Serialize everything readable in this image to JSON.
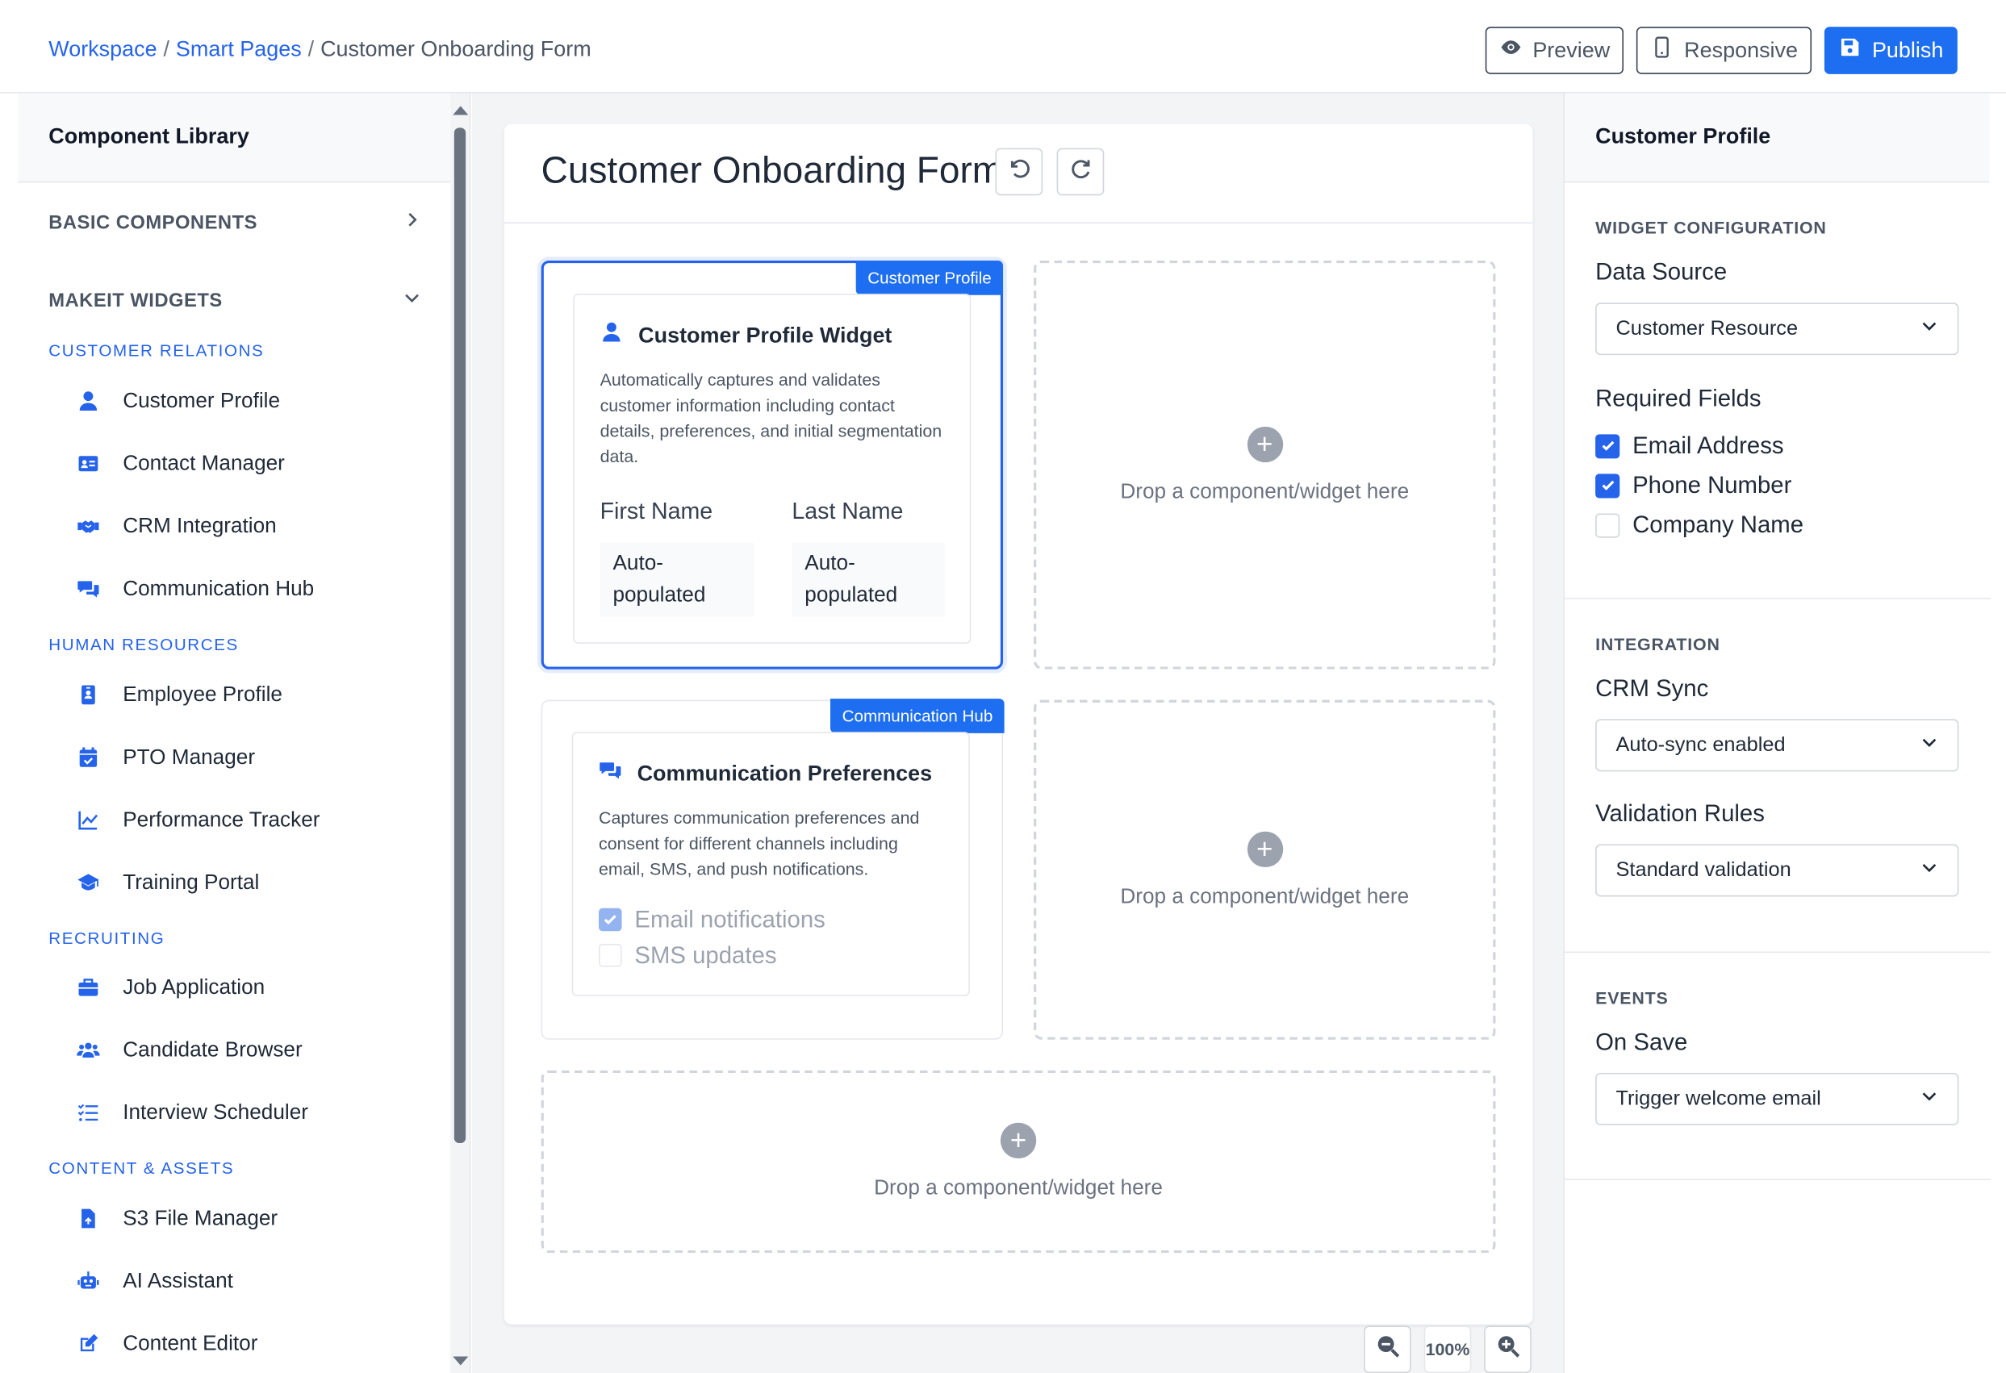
{
  "breadcrumb": {
    "items": [
      "Workspace",
      "Smart Pages",
      "Customer Onboarding Form"
    ],
    "separator": "/"
  },
  "toolbar": {
    "preview_label": "Preview",
    "responsive_label": "Responsive",
    "publish_label": "Publish"
  },
  "sidebar": {
    "title": "Component Library",
    "basic_group": "BASIC COMPONENTS",
    "makeit_group": "MAKEIT WIDGETS",
    "sections": [
      {
        "title": "CUSTOMER RELATIONS",
        "items": [
          {
            "label": "Customer Profile",
            "icon": "user-icon"
          },
          {
            "label": "Contact Manager",
            "icon": "address-card-icon"
          },
          {
            "label": "CRM Integration",
            "icon": "handshake-icon"
          },
          {
            "label": "Communication Hub",
            "icon": "comments-icon"
          }
        ]
      },
      {
        "title": "HUMAN RESOURCES",
        "items": [
          {
            "label": "Employee Profile",
            "icon": "id-badge-icon"
          },
          {
            "label": "PTO Manager",
            "icon": "calendar-check-icon"
          },
          {
            "label": "Performance Tracker",
            "icon": "chart-line-icon"
          },
          {
            "label": "Training Portal",
            "icon": "graduation-cap-icon"
          }
        ]
      },
      {
        "title": "RECRUITING",
        "items": [
          {
            "label": "Job Application",
            "icon": "briefcase-icon"
          },
          {
            "label": "Candidate Browser",
            "icon": "users-icon"
          },
          {
            "label": "Interview Scheduler",
            "icon": "list-check-icon"
          }
        ]
      },
      {
        "title": "CONTENT & ASSETS",
        "items": [
          {
            "label": "S3 File Manager",
            "icon": "file-upload-icon"
          },
          {
            "label": "AI Assistant",
            "icon": "robot-icon"
          },
          {
            "label": "Content Editor",
            "icon": "edit-icon"
          }
        ]
      }
    ]
  },
  "canvas": {
    "title": "Customer Onboarding Form",
    "drop_text": "Drop a component/widget here",
    "zoom": "100%",
    "profile_widget": {
      "badge": "Customer Profile",
      "title": "Customer Profile Widget",
      "description": "Automatically captures and validates customer information including contact details, preferences, and initial segmentation data.",
      "first_label": "First Name",
      "last_label": "Last Name",
      "first_value": "Auto-populated",
      "last_value": "Auto-populated"
    },
    "comm_widget": {
      "badge": "Communication Hub",
      "title": "Communication Preferences",
      "description": "Captures communication preferences and consent for different channels including email, SMS, and push notifications.",
      "options": [
        {
          "label": "Email notifications",
          "checked": true
        },
        {
          "label": "SMS updates",
          "checked": false
        }
      ]
    }
  },
  "properties": {
    "title": "Customer Profile",
    "widget_config": {
      "title": "WIDGET CONFIGURATION",
      "data_source_label": "Data Source",
      "data_source_value": "Customer Resource",
      "required_label": "Required Fields",
      "fields": [
        {
          "label": "Email Address",
          "checked": true
        },
        {
          "label": "Phone Number",
          "checked": true
        },
        {
          "label": "Company Name",
          "checked": false
        }
      ]
    },
    "integration": {
      "title": "INTEGRATION",
      "crm_label": "CRM Sync",
      "crm_value": "Auto-sync enabled",
      "validation_label": "Validation Rules",
      "validation_value": "Standard validation"
    },
    "events": {
      "title": "EVENTS",
      "save_label": "On Save",
      "save_value": "Trigger welcome email"
    }
  },
  "colors": {
    "accent": "#1d6ef0",
    "link": "#2563eb",
    "canvas_bg": "#f3f4f6"
  }
}
